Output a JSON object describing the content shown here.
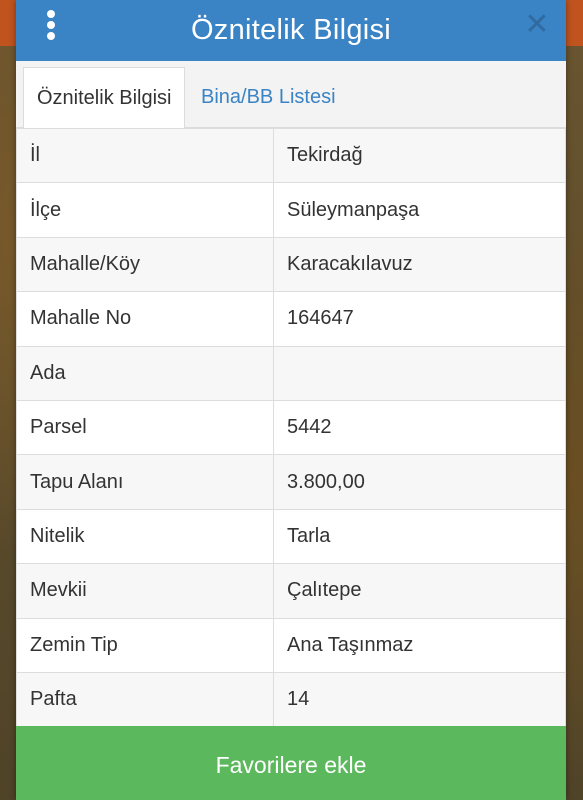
{
  "dialog": {
    "title": "Öznitelik Bilgisi",
    "menu_icon": "vertical-dots-icon",
    "close_icon": "close-icon"
  },
  "tabs": [
    {
      "label": "Öznitelik Bilgisi",
      "active": true
    },
    {
      "label": "Bina/BB Listesi",
      "active": false
    }
  ],
  "attributes": [
    {
      "key": "İl",
      "value": "Tekirdağ"
    },
    {
      "key": "İlçe",
      "value": "Süleymanpaşa"
    },
    {
      "key": "Mahalle/Köy",
      "value": "Karacakılavuz"
    },
    {
      "key": "Mahalle No",
      "value": "164647"
    },
    {
      "key": "Ada",
      "value": ""
    },
    {
      "key": "Parsel",
      "value": "5442"
    },
    {
      "key": "Tapu Alanı",
      "value": "3.800,00"
    },
    {
      "key": "Nitelik",
      "value": "Tarla"
    },
    {
      "key": "Mevkii",
      "value": "Çalıtepe"
    },
    {
      "key": "Zemin Tip",
      "value": "Ana Taşınmaz"
    },
    {
      "key": "Pafta",
      "value": "14"
    }
  ],
  "footer": {
    "favorite_label": "Favorilere ekle"
  },
  "colors": {
    "header": "#3a83c4",
    "tab_link": "#3a83c4",
    "favorite_button": "#5cb85c"
  }
}
